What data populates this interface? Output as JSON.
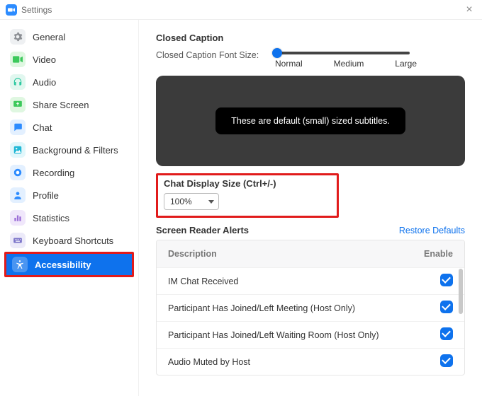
{
  "window": {
    "title": "Settings"
  },
  "sidebar": {
    "items": [
      {
        "label": "General"
      },
      {
        "label": "Video"
      },
      {
        "label": "Audio"
      },
      {
        "label": "Share Screen"
      },
      {
        "label": "Chat"
      },
      {
        "label": "Background & Filters"
      },
      {
        "label": "Recording"
      },
      {
        "label": "Profile"
      },
      {
        "label": "Statistics"
      },
      {
        "label": "Keyboard Shortcuts"
      },
      {
        "label": "Accessibility"
      }
    ]
  },
  "closed_caption": {
    "heading": "Closed Caption",
    "font_size_label": "Closed Caption Font Size:",
    "ticks": {
      "normal": "Normal",
      "medium": "Medium",
      "large": "Large"
    },
    "preview_text": "These are default (small) sized subtitles."
  },
  "chat_display": {
    "heading": "Chat Display Size (Ctrl+/-)",
    "value": "100%"
  },
  "screen_reader": {
    "heading": "Screen Reader Alerts",
    "restore": "Restore Defaults",
    "columns": {
      "desc": "Description",
      "enable": "Enable"
    },
    "rows": [
      {
        "desc": "IM Chat Received"
      },
      {
        "desc": "Participant Has Joined/Left Meeting (Host Only)"
      },
      {
        "desc": "Participant Has Joined/Left Waiting Room (Host Only)"
      },
      {
        "desc": "Audio Muted by Host"
      }
    ]
  }
}
